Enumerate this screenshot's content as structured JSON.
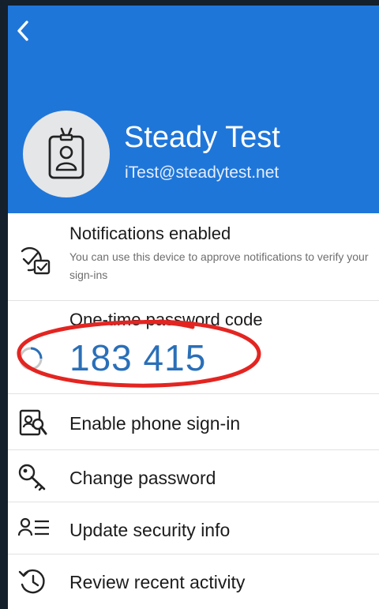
{
  "header": {
    "back_icon": "chevron-left-icon",
    "avatar_icon": "id-badge-icon",
    "display_name": "Steady Test",
    "email": "iTest@steadytest.net",
    "background": "#1f76d9"
  },
  "notifications": {
    "title": "Notifications enabled",
    "description": "You can use this device to approve notifications to verify your sign-ins",
    "icon": "checkbox-notification-icon"
  },
  "otp": {
    "title": "One-time password code",
    "code": "183 415",
    "code_color": "#2a6fb8",
    "annotation_color": "#e32521"
  },
  "menu": {
    "enable_phone_signin": {
      "label": "Enable phone sign-in",
      "icon": "phone-signin-icon"
    },
    "change_password": {
      "label": "Change password",
      "icon": "key-icon"
    },
    "update_security_info": {
      "label": "Update security info",
      "icon": "security-info-icon"
    },
    "review_recent_activity": {
      "label": "Review recent activity",
      "icon": "history-icon"
    }
  }
}
